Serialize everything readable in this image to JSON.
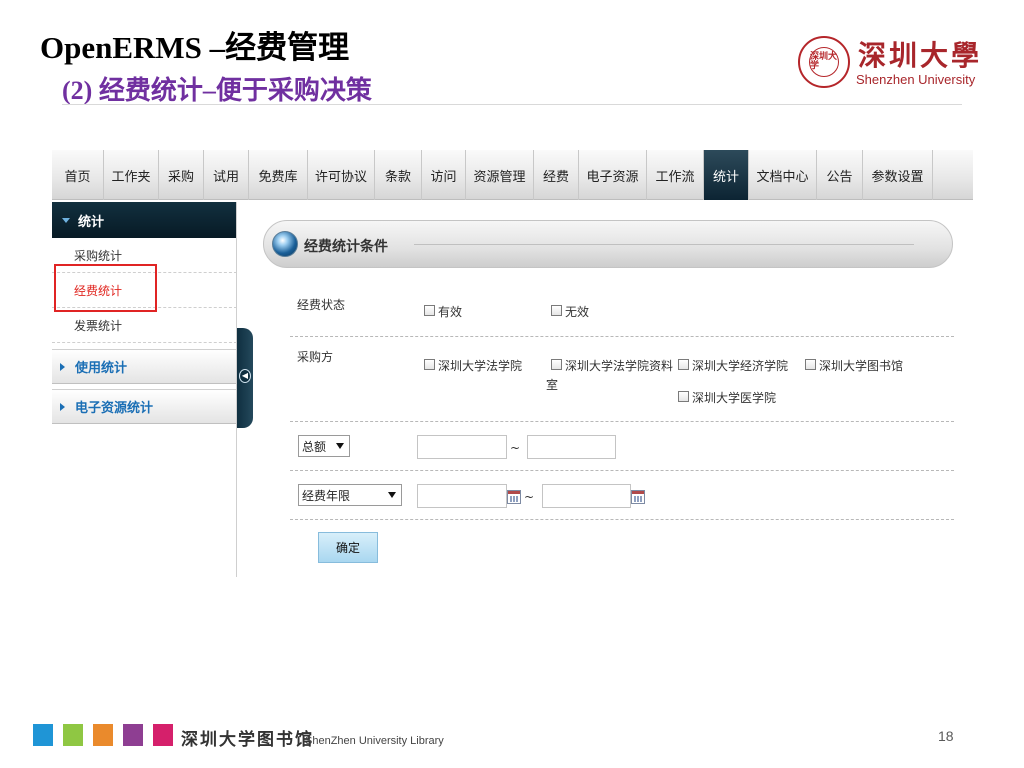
{
  "slide": {
    "title": "OpenERMS –经费管理",
    "subtitle": "(2) 经费统计–便于采购决策",
    "page_number": "18"
  },
  "logo": {
    "seal_text": "深圳大学",
    "cn": "深圳大學",
    "en": "Shenzhen University"
  },
  "nav": {
    "items": [
      "首页",
      "工作夹",
      "采购",
      "试用",
      "免费库",
      "许可协议",
      "条款",
      "访问",
      "资源管理",
      "经费",
      "电子资源",
      "工作流",
      "统计",
      "文档中心",
      "公告",
      "参数设置"
    ],
    "active": "统计"
  },
  "sidebar": {
    "header": "统计",
    "items": [
      "采购统计",
      "经费统计",
      "发票统计"
    ],
    "selected": "经费统计",
    "groups": [
      "使用统计",
      "电子资源统计"
    ]
  },
  "panel": {
    "title": "经费统计条件",
    "status": {
      "label": "经费状态",
      "options": [
        "有效",
        "无效"
      ]
    },
    "buyer": {
      "label": "采购方",
      "options": [
        "深圳大学法学院",
        "深圳大学法学院资料",
        "深圳大学经济学院",
        "深圳大学图书馆",
        "深圳大学医学院"
      ],
      "wrap_text": "室"
    },
    "amount": {
      "select_value": "总额",
      "tilde": "~"
    },
    "year": {
      "select_value": "经费年限",
      "tilde": "~"
    },
    "confirm_label": "确定"
  },
  "footer": {
    "cn": "深圳大学图书馆",
    "en": "ShenZhen University Library",
    "colors": [
      "#1f95d6",
      "#8fc743",
      "#ea8a2c",
      "#8e3e92",
      "#d5206b"
    ]
  }
}
